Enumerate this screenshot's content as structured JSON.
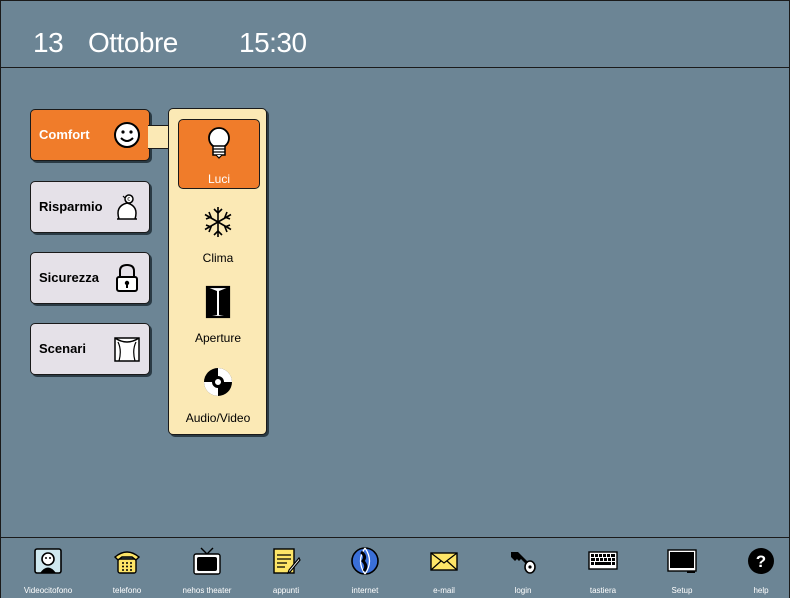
{
  "header": {
    "day": "13",
    "month": "Ottobre",
    "time": "15:30"
  },
  "categories": [
    {
      "label": "Comfort",
      "icon": "smiley-icon",
      "active": true
    },
    {
      "label": "Risparmio",
      "icon": "piggy-bank-icon",
      "active": false
    },
    {
      "label": "Sicurezza",
      "icon": "padlock-icon",
      "active": false
    },
    {
      "label": "Scenari",
      "icon": "theater-curtain-icon",
      "active": false
    }
  ],
  "comfort_items": [
    {
      "label": "Luci",
      "icon": "lightbulb-icon",
      "active": true
    },
    {
      "label": "Clima",
      "icon": "snowflake-icon",
      "active": false
    },
    {
      "label": "Aperture",
      "icon": "door-icon",
      "active": false
    },
    {
      "label": "Audio/Video",
      "icon": "cd-icon",
      "active": false
    }
  ],
  "dock": [
    {
      "label": "Videocitofono",
      "icon": "intercom-icon"
    },
    {
      "label": "telefono",
      "icon": "telephone-icon"
    },
    {
      "label": "nehos theater",
      "icon": "tv-icon"
    },
    {
      "label": "appunti",
      "icon": "notepad-icon"
    },
    {
      "label": "internet",
      "icon": "globe-icon"
    },
    {
      "label": "e-mail",
      "icon": "envelope-icon"
    },
    {
      "label": "login",
      "icon": "key-icon"
    },
    {
      "label": "tastiera",
      "icon": "keyboard-icon"
    },
    {
      "label": "Setup",
      "icon": "monitor-icon"
    },
    {
      "label": "help",
      "icon": "help-icon"
    }
  ],
  "colors": {
    "background": "#6c8595",
    "accent": "#f07c2a",
    "submenu": "#fbe9b5",
    "button": "#e5e1e8"
  }
}
